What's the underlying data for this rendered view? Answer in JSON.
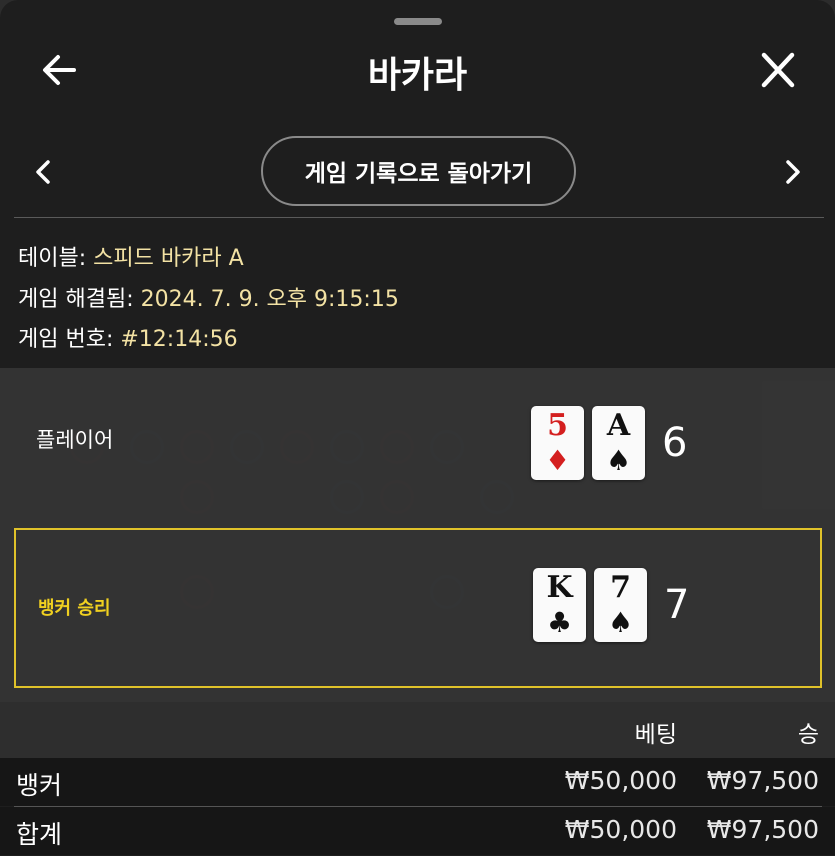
{
  "header": {
    "title": "바카라"
  },
  "nav": {
    "history_label": "게임 기록으로 돌아가기"
  },
  "info": {
    "table_label": "테이블: ",
    "table_value": "스피드 바카라 A",
    "resolved_label": "게임 해결됨: ",
    "resolved_value": "2024. 7. 9. 오후 9:15:15",
    "number_label": "게임 번호: ",
    "number_value": "#12:14:56"
  },
  "hands": {
    "player": {
      "label": "플레이어",
      "score": "6",
      "cards": [
        {
          "rank": "5",
          "suit": "♦",
          "color": "red"
        },
        {
          "rank": "A",
          "suit": "♠",
          "color": "black"
        }
      ]
    },
    "banker": {
      "label": "뱅커 승리",
      "score": "7",
      "cards": [
        {
          "rank": "K",
          "suit": "♣",
          "color": "black"
        },
        {
          "rank": "7",
          "suit": "♠",
          "color": "black"
        }
      ]
    }
  },
  "bets_table": {
    "headers": {
      "bet": "베팅",
      "win": "승"
    },
    "rows": [
      {
        "name": "뱅커",
        "bet": "₩50,000",
        "win": "₩97,500"
      },
      {
        "name": "합계",
        "bet": "₩50,000",
        "win": "₩97,500"
      }
    ]
  },
  "colors": {
    "accent": "#f0d020",
    "info_value": "#f3e2a4",
    "card_red": "#d41f1f"
  },
  "icons": {
    "back": "arrow-left-icon",
    "close": "close-icon",
    "prev": "chevron-left-icon",
    "next": "chevron-right-icon"
  }
}
